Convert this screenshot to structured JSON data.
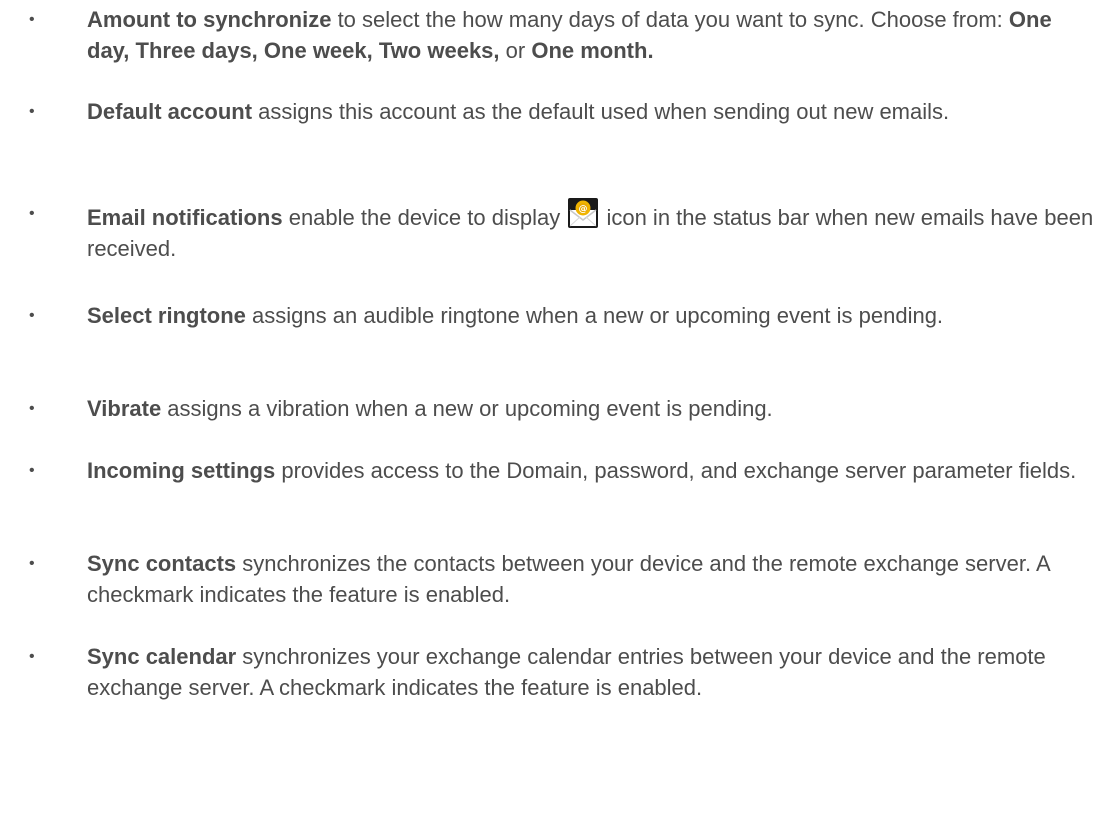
{
  "items": [
    {
      "term": "Amount to synchronize",
      "desc": " to select the how many days of data you want to sync. Choose from: ",
      "options": [
        "One day,",
        "Three days,",
        "One week,",
        "Two weeks,"
      ],
      "or": "or",
      "last_option": "One month."
    },
    {
      "term": "Default account",
      "desc": " assigns this account as the default used when sending out new emails."
    },
    {
      "term": "Email notifications",
      "desc_before": " enable the device to display ",
      "icon": "email-notification-icon",
      "desc_after": " icon in the status bar when new emails have been received."
    },
    {
      "term": "Select ringtone",
      "desc": " assigns an audible ringtone when a new or upcoming event is pending."
    },
    {
      "term": "Vibrate",
      "desc": " assigns a vibration when a new or upcoming event is pending."
    },
    {
      "term": "Incoming settings",
      "desc": " provides access to the Domain, password, and exchange server parameter fields."
    },
    {
      "term": "Sync contacts",
      "desc": " synchronizes the contacts between your device and the remote exchange server. A checkmark indicates the feature is enabled."
    },
    {
      "term": "Sync calendar",
      "desc": " synchronizes your exchange calendar entries between your device and the remote exchange server. A checkmark indicates the feature is enabled."
    }
  ],
  "bullet": "•",
  "colors": {
    "text": "#4d4d4d",
    "icon_background": "#1a1a1a",
    "icon_envelope": "#ffffff",
    "icon_badge": "#f0b400"
  }
}
